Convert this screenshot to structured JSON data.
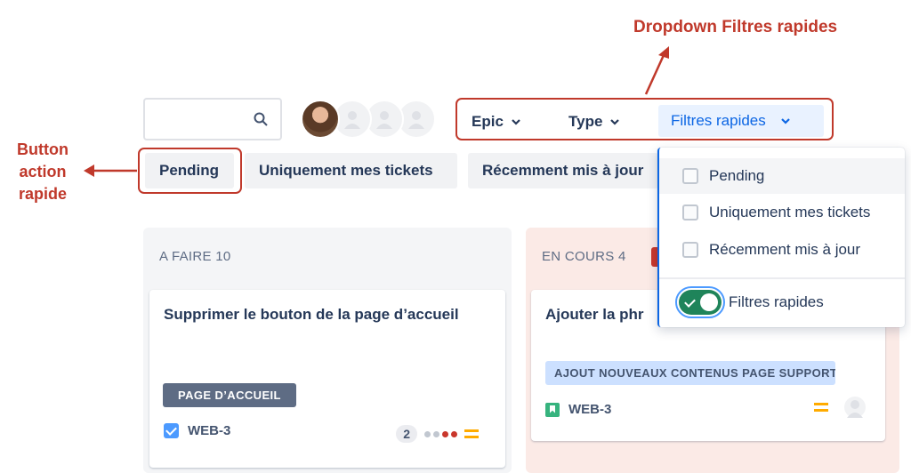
{
  "annotations": {
    "dropdown_title": "Dropdown Filtres rapides",
    "button_label_line1": "Button",
    "button_label_line2": "action",
    "button_label_line3": "rapide",
    "color": "#c0392b"
  },
  "search": {
    "placeholder": "",
    "icon": "search-icon"
  },
  "filters": {
    "epic_label": "Epic",
    "type_label": "Type",
    "quick_filters_label": "Filtres rapides"
  },
  "quick_buttons": {
    "pending": "Pending",
    "mine": "Uniquement mes tickets",
    "recent": "Récemment mis à jour"
  },
  "dropdown": {
    "items": [
      {
        "label": "Pending",
        "checked": false
      },
      {
        "label": "Uniquement mes tickets",
        "checked": false
      },
      {
        "label": "Récemment mis à jour",
        "checked": false
      }
    ],
    "toggle_label": "Filtres rapides",
    "toggle_on": true
  },
  "columns": [
    {
      "header": "A FAIRE 10",
      "card": {
        "title": "Supprimer le bouton de la page d’accueil",
        "epic": "PAGE D’ACCUEIL",
        "key": "WEB-3",
        "count": "2"
      }
    },
    {
      "header": "EN COURS 4",
      "card": {
        "title": "Ajouter la phr",
        "epic": "AJOUT NOUVEAUX CONTENUS PAGE SUPPORT",
        "key": "WEB-3"
      }
    }
  ],
  "colors": {
    "accent": "#0c66e4",
    "annotation": "#c0392b",
    "toggle_on": "#1f845a",
    "in_progress_bg": "#fbeae6",
    "todo_bg": "#f4f5f7"
  }
}
